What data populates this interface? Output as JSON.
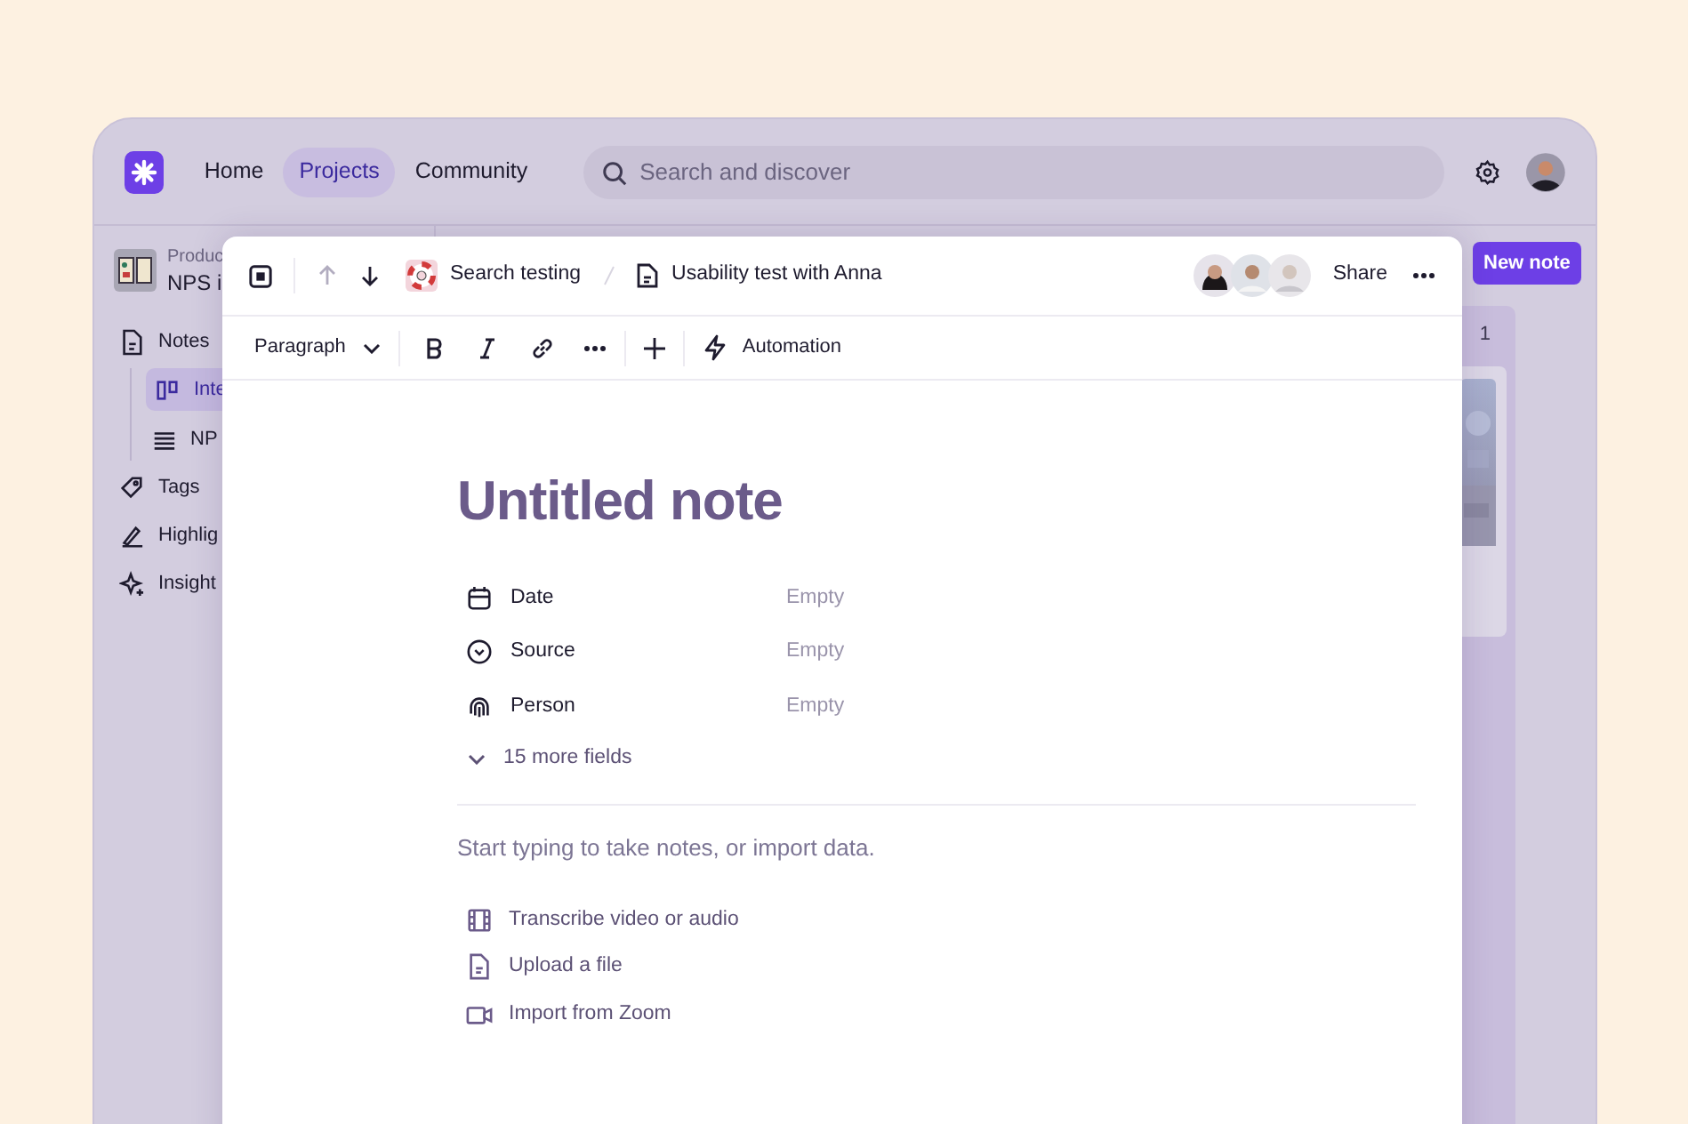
{
  "nav": [
    {
      "label": "Home",
      "selected": false
    },
    {
      "label": "Projects",
      "selected": true
    },
    {
      "label": "Community",
      "selected": false
    }
  ],
  "search": {
    "placeholder": "Search and discover"
  },
  "project": {
    "category": "Produc",
    "name": "NPS i"
  },
  "sidebar": {
    "items": [
      {
        "label": "Notes",
        "selected": false,
        "children": [
          {
            "label": "Inte",
            "selected": true
          },
          {
            "label": "NP",
            "selected": false
          }
        ]
      },
      {
        "label": "Tags",
        "selected": false
      },
      {
        "label": "Highlig",
        "selected": false
      },
      {
        "label": "Insight",
        "selected": false
      }
    ]
  },
  "new_note_button": "New note",
  "board": {
    "column_count": "1"
  },
  "note": {
    "breadcrumb": [
      "Search testing",
      "Usability test with Anna"
    ],
    "share": "Share",
    "toolbar": {
      "block_type": "Paragraph",
      "automation": "Automation"
    },
    "title": "Untitled note",
    "fields": [
      {
        "label": "Date",
        "value": "Empty"
      },
      {
        "label": "Source",
        "value": "Empty"
      },
      {
        "label": "Person",
        "value": "Empty"
      }
    ],
    "more_fields": "15 more fields",
    "placeholder": "Start typing to take notes, or import data.",
    "actions": [
      {
        "label": "Transcribe video or audio"
      },
      {
        "label": "Upload a file"
      },
      {
        "label": "Import from Zoom"
      }
    ]
  }
}
